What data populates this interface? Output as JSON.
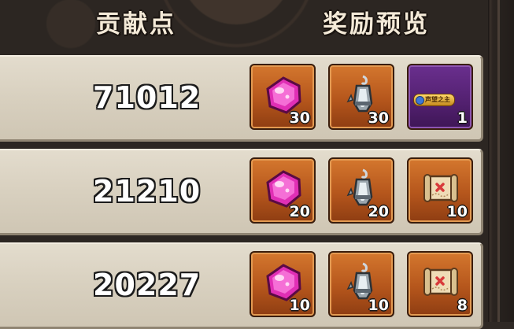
{
  "header": {
    "points_label": "贡献点",
    "rewards_label": "奖励预览"
  },
  "rows": [
    {
      "points": "71012",
      "rewards": [
        {
          "icon": "pink-gem-icon",
          "count": "30"
        },
        {
          "icon": "lantern-icon",
          "count": "30"
        },
        {
          "icon": "purple-title-badge-icon",
          "badge_text": "声望之主",
          "count": "1"
        }
      ]
    },
    {
      "points": "21210",
      "rewards": [
        {
          "icon": "pink-gem-icon",
          "count": "20"
        },
        {
          "icon": "lantern-icon",
          "count": "20"
        },
        {
          "icon": "treasure-map-icon",
          "count": "10"
        }
      ]
    },
    {
      "points": "20227",
      "rewards": [
        {
          "icon": "pink-gem-icon",
          "count": "10"
        },
        {
          "icon": "lantern-icon",
          "count": "10"
        },
        {
          "icon": "treasure-map-icon",
          "count": "8"
        }
      ]
    }
  ],
  "colors": {
    "slot_orange": "#b5561c",
    "slot_purple": "#52206f",
    "row_bg": "#d8d0bf",
    "page_bg": "#2f2925"
  }
}
